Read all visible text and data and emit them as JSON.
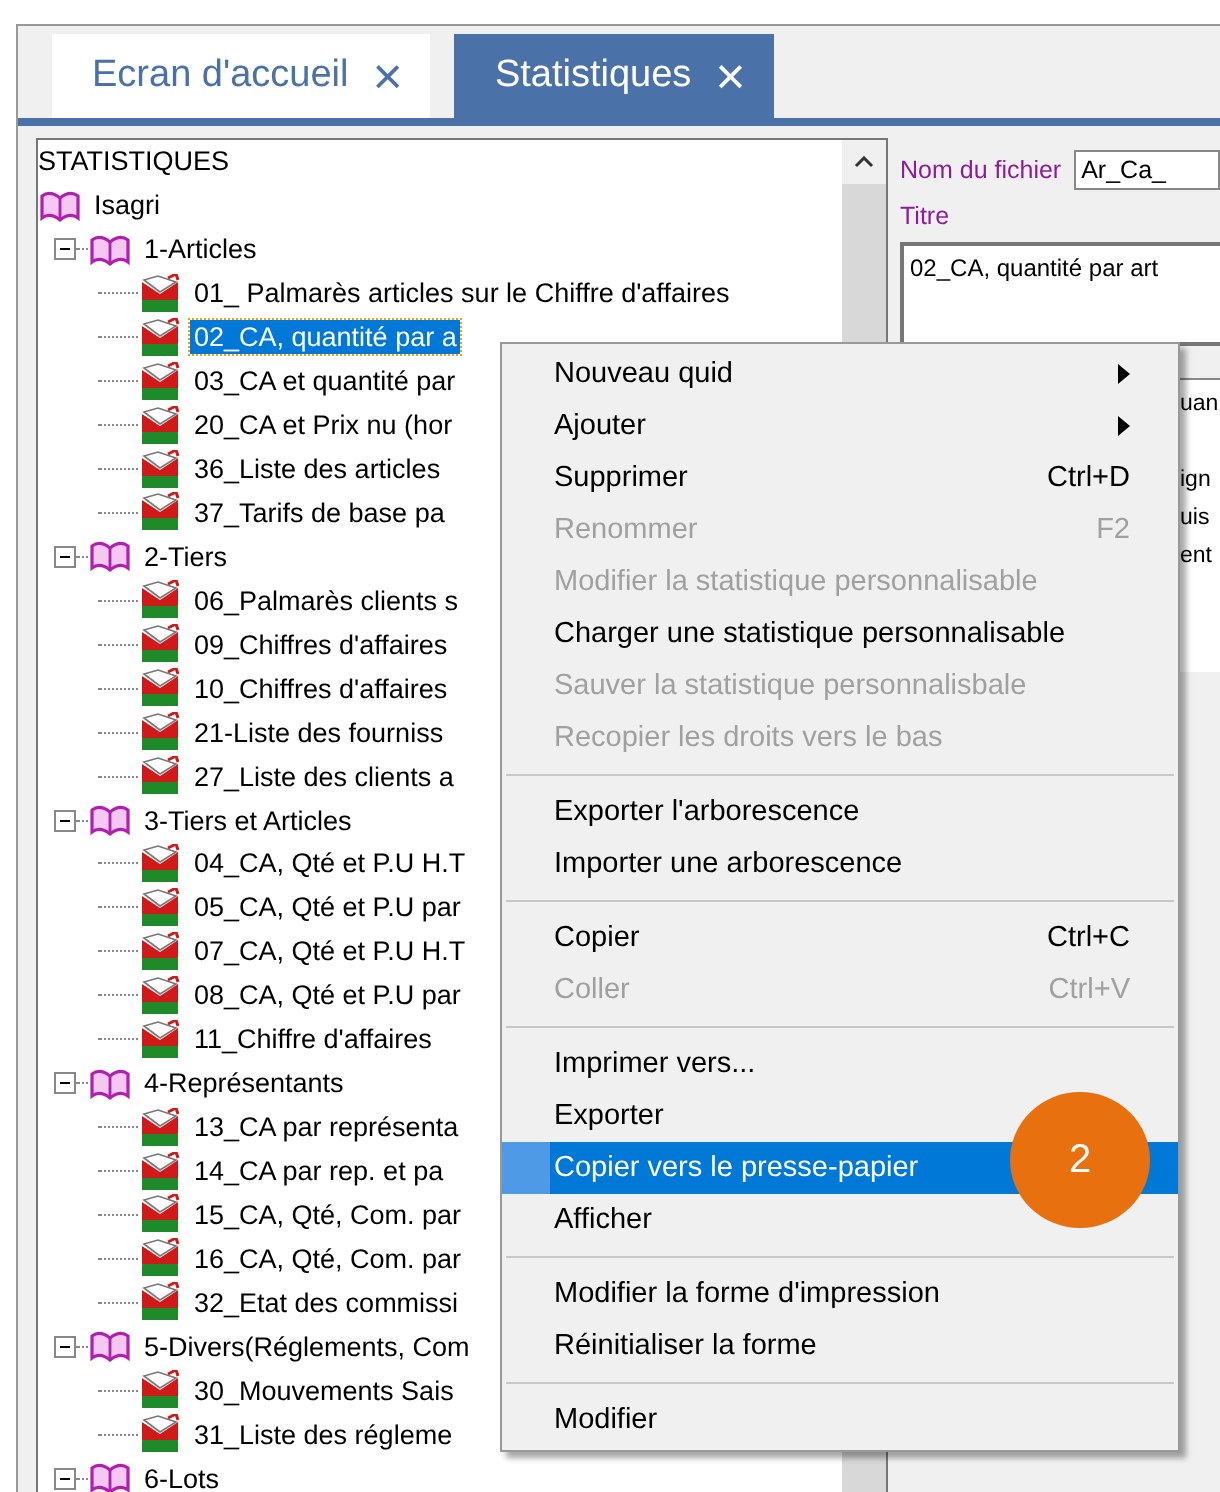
{
  "tabs": [
    {
      "label": "Ecran d'accueil",
      "close": "×",
      "selected": false
    },
    {
      "label": "Statistiques",
      "close": "×",
      "selected": true
    }
  ],
  "tree": {
    "heading": "STATISTIQUES",
    "root": {
      "label": "Isagri",
      "children": [
        {
          "label": "1-Articles",
          "expanded": true,
          "children": [
            {
              "label": "01_ Palmarès articles sur le Chiffre d'affaires",
              "selected": false
            },
            {
              "label": "02_CA, quantité par a",
              "selected": true
            },
            {
              "label": "03_CA et quantité par",
              "selected": false
            },
            {
              "label": "20_CA et Prix nu (hor",
              "selected": false
            },
            {
              "label": "36_Liste des articles",
              "selected": false
            },
            {
              "label": "37_Tarifs de base pa",
              "selected": false
            }
          ]
        },
        {
          "label": "2-Tiers",
          "expanded": true,
          "children": [
            {
              "label": "06_Palmarès clients s",
              "selected": false
            },
            {
              "label": "09_Chiffres d'affaires",
              "selected": false
            },
            {
              "label": "10_Chiffres d'affaires",
              "selected": false
            },
            {
              "label": "21-Liste des fourniss",
              "selected": false
            },
            {
              "label": "27_Liste des clients a",
              "selected": false
            }
          ]
        },
        {
          "label": "3-Tiers et Articles",
          "expanded": true,
          "children": [
            {
              "label": "04_CA, Qté et P.U H.T",
              "selected": false
            },
            {
              "label": "05_CA, Qté et P.U par",
              "selected": false
            },
            {
              "label": "07_CA, Qté et P.U H.T",
              "selected": false
            },
            {
              "label": "08_CA, Qté et P.U par",
              "selected": false
            },
            {
              "label": "11_Chiffre d'affaires",
              "selected": false
            }
          ]
        },
        {
          "label": "4-Représentants",
          "expanded": true,
          "children": [
            {
              "label": "13_CA par représenta",
              "selected": false
            },
            {
              "label": "14_CA par rep. et  pa",
              "selected": false
            },
            {
              "label": "15_CA, Qté, Com. par",
              "selected": false
            },
            {
              "label": "16_CA, Qté, Com. par",
              "selected": false
            },
            {
              "label": "32_Etat des commissi",
              "selected": false
            }
          ]
        },
        {
          "label": "5-Divers(Réglements, Com",
          "expanded": true,
          "children": [
            {
              "label": "30_Mouvements Sais",
              "selected": false
            },
            {
              "label": "31_Liste des régleme",
              "selected": false
            }
          ]
        },
        {
          "label": "6-Lots",
          "expanded": true
        }
      ]
    }
  },
  "details": {
    "file_label": "Nom du fichier",
    "file_value": "Ar_Ca_",
    "title_label": "Titre",
    "title_value": "02_CA, quantité par art",
    "lines": [
      "uan",
      "ign",
      "uis",
      "ent"
    ]
  },
  "menu": {
    "sections": [
      [
        {
          "label": "Nouveau quid",
          "submenu": true,
          "disabled": false,
          "selected": false
        },
        {
          "label": "Ajouter",
          "submenu": true,
          "disabled": false,
          "selected": false
        },
        {
          "label": "Supprimer",
          "shortcut": "Ctrl+D",
          "disabled": false,
          "selected": false
        },
        {
          "label": "Renommer",
          "shortcut": "F2",
          "disabled": true,
          "selected": false
        },
        {
          "label": "Modifier la statistique personnalisable",
          "disabled": true,
          "selected": false
        },
        {
          "label": "Charger une statistique personnalisable",
          "disabled": false,
          "selected": false
        },
        {
          "label": "Sauver la statistique personnalisbale",
          "disabled": true,
          "selected": false
        },
        {
          "label": "Recopier les droits vers le bas",
          "disabled": true,
          "selected": false
        }
      ],
      [
        {
          "label": "Exporter l'arborescence",
          "disabled": false,
          "selected": false
        },
        {
          "label": "Importer une arborescence",
          "disabled": false,
          "selected": false
        }
      ],
      [
        {
          "label": "Copier",
          "shortcut": "Ctrl+C",
          "disabled": false,
          "selected": false
        },
        {
          "label": "Coller",
          "shortcut": "Ctrl+V",
          "disabled": true,
          "selected": false
        }
      ],
      [
        {
          "label": "Imprimer vers...",
          "disabled": false,
          "selected": false
        },
        {
          "label": "Exporter",
          "disabled": false,
          "selected": false
        },
        {
          "label": "Copier vers le presse-papier",
          "disabled": false,
          "selected": true
        },
        {
          "label": "Afficher",
          "disabled": false,
          "selected": false
        }
      ],
      [
        {
          "label": "Modifier la forme d'impression",
          "disabled": false,
          "selected": false
        },
        {
          "label": "Réinitialiser la forme",
          "disabled": false,
          "selected": false
        }
      ],
      [
        {
          "label": "Modifier",
          "disabled": false,
          "selected": false
        }
      ]
    ]
  },
  "step_badge": "2"
}
